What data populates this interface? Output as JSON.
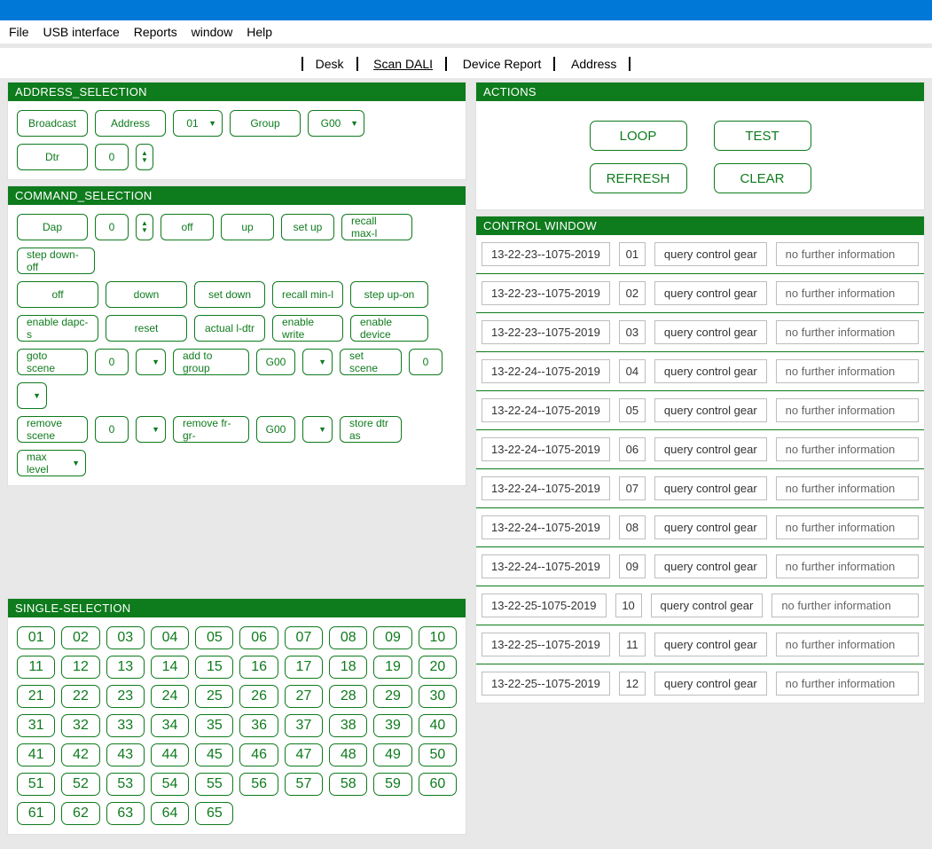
{
  "menu": {
    "items": [
      "File",
      "USB interface",
      "Reports",
      "window",
      "Help"
    ]
  },
  "tabs": {
    "items": [
      "Desk",
      "Scan DALI",
      "Device Report",
      "Address"
    ],
    "active_index": 1
  },
  "panels": {
    "address_selection": "ADDRESS_SELECTION",
    "command_selection": "COMMAND_SELECTION",
    "single_selection": "SINGLE-SELECTION",
    "actions": "ACTIONS",
    "control_window": "CONTROL WINDOW"
  },
  "address": {
    "broadcast": "Broadcast",
    "address": "Address",
    "addr_val": "01",
    "group": "Group",
    "group_val": "G00",
    "dtr": "Dtr",
    "dtr_val": "0"
  },
  "commands": {
    "row1": {
      "dap": "Dap",
      "dap_val": "0",
      "off": "off",
      "up": "up",
      "setup": "set up",
      "recall_max": "recall max-l",
      "step_down_off": "step down-off"
    },
    "row2": {
      "off": "off",
      "down": "down",
      "set_down": "set down",
      "recall_min": "recall min-l",
      "step_up_on": "step up-on"
    },
    "row3": {
      "enable_dapcs": "enable dapc-s",
      "reset": "reset",
      "actual_ldtr": "actual l-dtr",
      "enable_write": "enable write",
      "enable_device": "enable device"
    },
    "row4": {
      "goto_scene": "goto scene",
      "gs_val": "0",
      "add_group": "add to group",
      "ag_val": "G00",
      "set_scene": "set scene",
      "ss_val": "0"
    },
    "row5": {
      "remove_scene": "remove scene",
      "rs_val": "0",
      "remove_group": "remove fr- gr-",
      "rg_val": "G00",
      "store_dtr": "store dtr as",
      "max_level": "max level"
    }
  },
  "single": {
    "cells": [
      "01",
      "02",
      "03",
      "04",
      "05",
      "06",
      "07",
      "08",
      "09",
      "10",
      "11",
      "12",
      "13",
      "14",
      "15",
      "16",
      "17",
      "18",
      "19",
      "20",
      "21",
      "22",
      "23",
      "24",
      "25",
      "26",
      "27",
      "28",
      "29",
      "30",
      "31",
      "32",
      "33",
      "34",
      "35",
      "36",
      "37",
      "38",
      "39",
      "40",
      "41",
      "42",
      "43",
      "44",
      "45",
      "46",
      "47",
      "48",
      "49",
      "50",
      "51",
      "52",
      "53",
      "54",
      "55",
      "56",
      "57",
      "58",
      "59",
      "60",
      "61",
      "62",
      "63",
      "64",
      "65"
    ]
  },
  "actions": {
    "loop": "LOOP",
    "test": "TEST",
    "refresh": "REFRESH",
    "clear": "CLEAR"
  },
  "ctrl": {
    "rows": [
      {
        "ts": "13-22-23--1075-2019",
        "id": "01",
        "q": "query control gear",
        "info": "no further information"
      },
      {
        "ts": "13-22-23--1075-2019",
        "id": "02",
        "q": "query control gear",
        "info": "no further information"
      },
      {
        "ts": "13-22-23--1075-2019",
        "id": "03",
        "q": "query control gear",
        "info": "no further information"
      },
      {
        "ts": "13-22-24--1075-2019",
        "id": "04",
        "q": "query control gear",
        "info": "no further information"
      },
      {
        "ts": "13-22-24--1075-2019",
        "id": "05",
        "q": "query control gear",
        "info": "no further information"
      },
      {
        "ts": "13-22-24--1075-2019",
        "id": "06",
        "q": "query control gear",
        "info": "no further information"
      },
      {
        "ts": "13-22-24--1075-2019",
        "id": "07",
        "q": "query control gear",
        "info": "no further information"
      },
      {
        "ts": "13-22-24--1075-2019",
        "id": "08",
        "q": "query control gear",
        "info": "no further information"
      },
      {
        "ts": "13-22-24--1075-2019",
        "id": "09",
        "q": "query control gear",
        "info": "no further information"
      },
      {
        "ts": "13-22-25-1075-2019",
        "id": "10",
        "q": "query control gear",
        "info": "no further information"
      },
      {
        "ts": "13-22-25--1075-2019",
        "id": "11",
        "q": "query control gear",
        "info": "no further information"
      },
      {
        "ts": "13-22-25--1075-2019",
        "id": "12",
        "q": "query control gear",
        "info": "no further information"
      }
    ]
  }
}
